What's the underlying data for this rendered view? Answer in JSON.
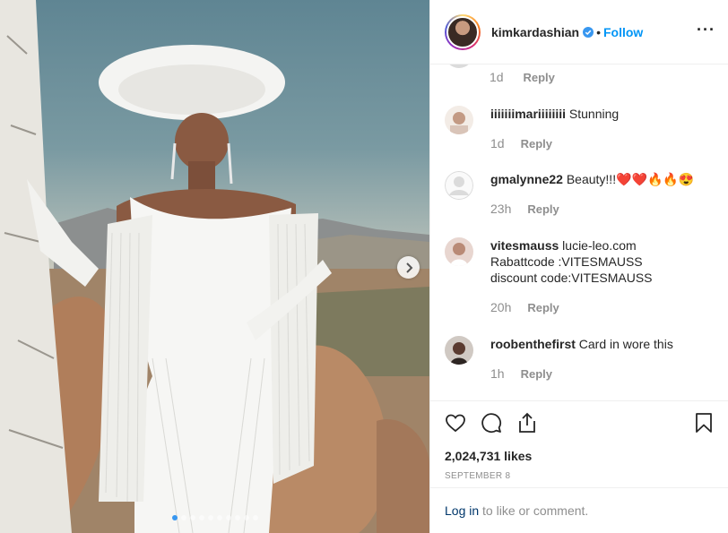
{
  "post": {
    "username": "kimkardashian",
    "bullet": "•",
    "follow_label": "Follow",
    "more_glyph": "···",
    "carousel": {
      "slide_count": 10,
      "active_index": 0
    }
  },
  "comments": {
    "partial": {
      "time": "1d",
      "reply_label": "Reply"
    },
    "items": [
      {
        "user": "iiiiiiimariiiiiiii",
        "text": "Stunning",
        "time": "1d",
        "reply_label": "Reply"
      },
      {
        "user": "gmalynne22",
        "text": "Beauty!!!❤️❤️🔥🔥😍",
        "time": "23h",
        "reply_label": "Reply"
      },
      {
        "user": "vitesmauss",
        "text": "lucie-leo.com\nRabattcode :VITESMAUSS\ndiscount code:VITESMAUSS",
        "time": "20h",
        "reply_label": "Reply"
      },
      {
        "user": "roobenthefirst",
        "text": "Card in wore this",
        "time": "1h",
        "reply_label": "Reply"
      }
    ]
  },
  "actions": {
    "likes": "2,024,731 likes",
    "date": "SEPTEMBER 8"
  },
  "login": {
    "link_label": "Log in",
    "suffix": " to like or comment."
  },
  "colors": {
    "accent": "#0095f6",
    "active_dot": "#3897f0",
    "muted": "#8e8e8e"
  }
}
